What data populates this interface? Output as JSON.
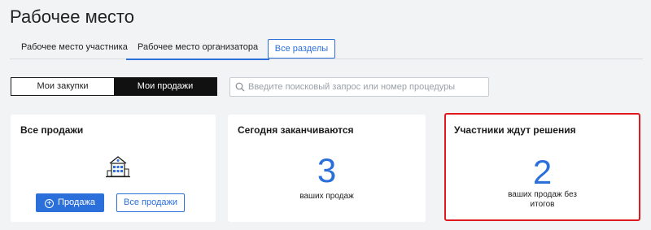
{
  "page": {
    "title": "Рабочее место"
  },
  "tabs": [
    {
      "label": "Рабочее место участника",
      "active": false
    },
    {
      "label": "Рабочее место организатора",
      "active": true
    }
  ],
  "all_sections_label": "Все разделы",
  "segmented": [
    {
      "label": "Мои закупки",
      "active": false
    },
    {
      "label": "Мои продажи",
      "active": true
    }
  ],
  "search": {
    "placeholder": "Введите поисковый запрос или номер процедуры",
    "value": ""
  },
  "cards": {
    "all_sales": {
      "title": "Все продажи",
      "primary_button": "Продажа",
      "secondary_button": "Все продажи",
      "icon": "building-icon"
    },
    "ending_today": {
      "title": "Сегодня заканчиваются",
      "count": "3",
      "caption": "ваших продаж"
    },
    "awaiting_decision": {
      "title": "Участники ждут решения",
      "count": "2",
      "caption": "ваших продаж без итогов",
      "highlight_color": "#e0191e"
    }
  },
  "colors": {
    "accent": "#2b6fdb",
    "highlight": "#e0191e",
    "background": "#f2f3f5"
  }
}
